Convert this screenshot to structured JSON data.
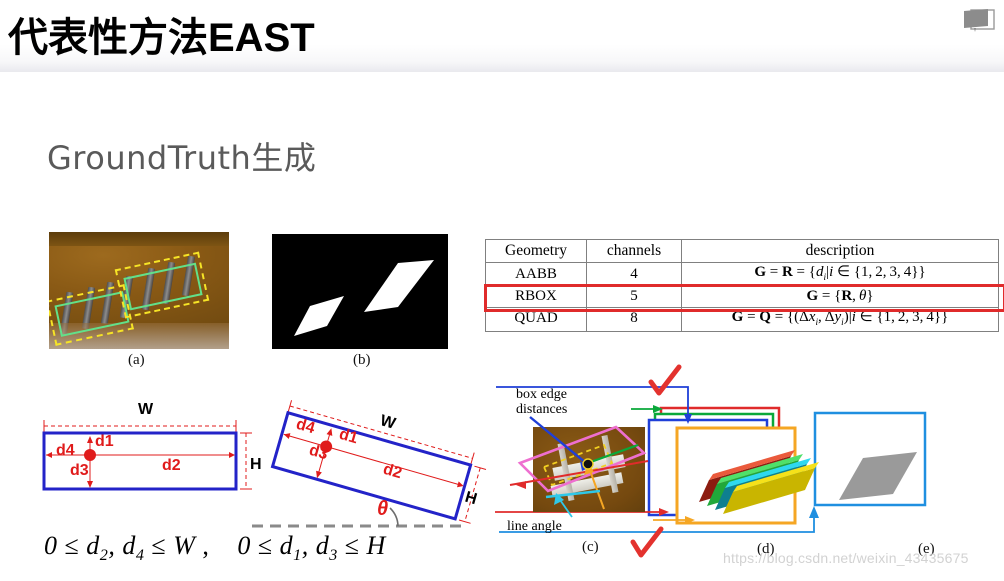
{
  "header": {
    "title": "代表性方法EAST",
    "icon": "book-monitor-icon"
  },
  "subtitle": "GroundTruth生成",
  "figures": {
    "a": {
      "caption": "(a)",
      "description": "text image with yellow dashed quadrangle and green shrunk box"
    },
    "b": {
      "caption": "(b)",
      "description": "binary score map with white parallelograms"
    },
    "c": {
      "caption": "(c)",
      "label_top": "box edge\ndistances",
      "label_top_line1": "box edge",
      "label_top_line2": "distances",
      "label_bottom": "line angle"
    },
    "d": {
      "caption": "(d)"
    },
    "e": {
      "caption": "(e)"
    }
  },
  "table": {
    "headers": [
      "Geometry",
      "channels",
      "description"
    ],
    "rows": [
      {
        "geometry": "AABB",
        "channels": "4",
        "description_parts": {
          "bold1": "G",
          "eq1": " = ",
          "bold2": "R",
          "eq2": " = {",
          "italic": "d",
          "sub": "i",
          "tail": "|i ∈ {1, 2, 3, 4}}"
        },
        "description": "G = R = {d_i|i ∈ {1, 2, 3, 4}}",
        "highlighted": false
      },
      {
        "geometry": "RBOX",
        "channels": "5",
        "description": "G = {R, θ}",
        "highlighted": true
      },
      {
        "geometry": "QUAD",
        "channels": "8",
        "description": "G = Q = {(Δx_i, Δy_i)|i ∈ {1, 2, 3, 4}}",
        "highlighted": false
      }
    ],
    "highlight_color": "#e02b2b"
  },
  "diagrams": {
    "axis_aligned": {
      "labels": {
        "d1": "d1",
        "d2": "d2",
        "d3": "d3",
        "d4": "d4",
        "W": "W",
        "H": "H"
      }
    },
    "rotated": {
      "labels": {
        "d1": "d1",
        "d2": "d2",
        "d3": "d3",
        "d4": "d4",
        "W": "W",
        "H": "H",
        "theta": "θ"
      }
    }
  },
  "formula": {
    "left": "0 ≤ d2, d4 ≤ W ,",
    "right": "0 ≤ d1, d3 ≤ H"
  },
  "watermark": "https://blog.csdn.net/weixin_43435675",
  "colors": {
    "title": "#000000",
    "subtitle": "#5a5a5a",
    "box_blue": "#2323c8",
    "dimension_red": "#e01b1b",
    "highlight_red": "#e02b2b",
    "green_box": "#62e08a",
    "dashed_yellow": "#f6e426",
    "pink_box": "#ee6fd0",
    "orange_panel": "#f5a623",
    "blue_panel": "#1f8fe0"
  }
}
